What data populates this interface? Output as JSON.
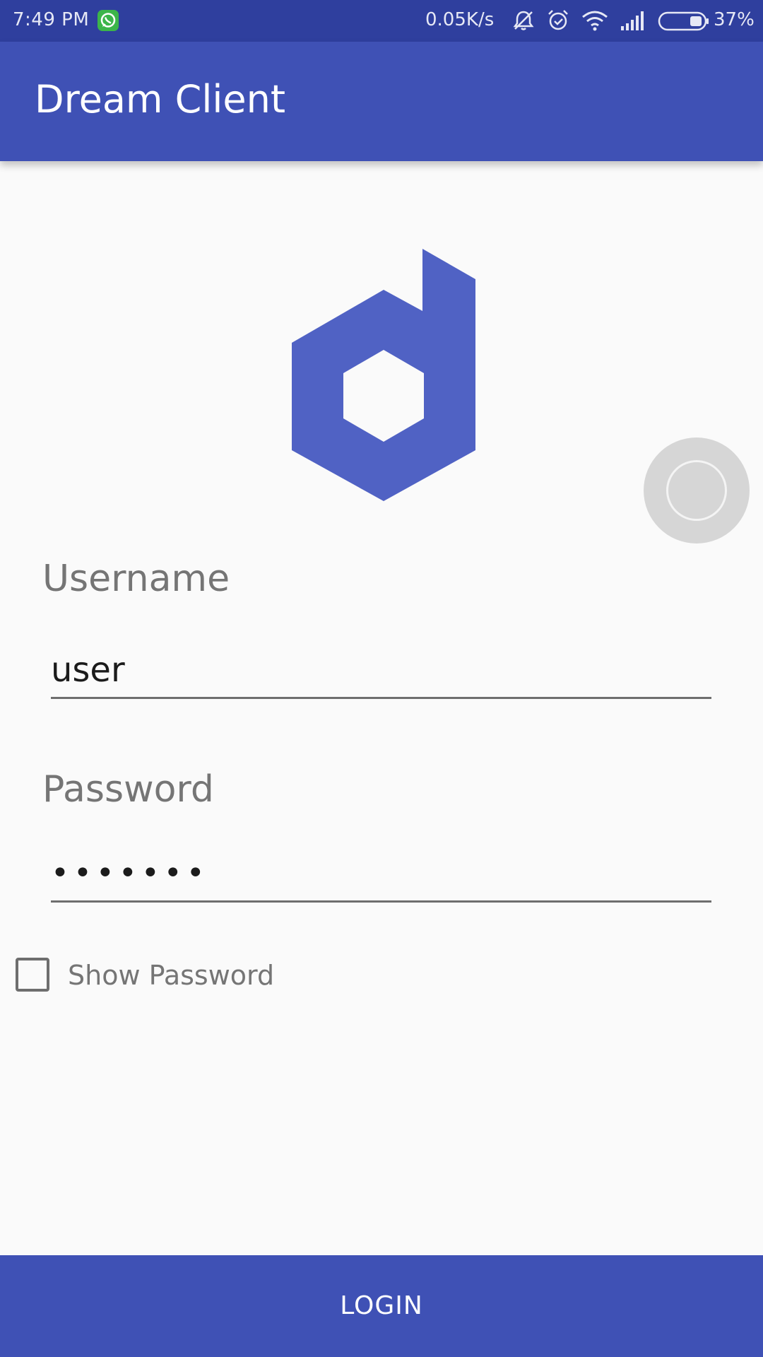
{
  "status_bar": {
    "time": "7:49 PM",
    "net_speed": "0.05K/s",
    "battery": "37%",
    "icons": [
      "whatsapp-icon",
      "bell-off-icon",
      "alarm-icon",
      "wifi-icon",
      "signal-icon",
      "battery-icon"
    ]
  },
  "app_bar": {
    "title": "Dream Client"
  },
  "logo": {
    "icon": "dream-logo-icon",
    "color": "#5062c4"
  },
  "login_form": {
    "username_label": "Username",
    "username_value": "user",
    "password_label": "Password",
    "password_value": "•••••••",
    "show_password_label": "Show Password",
    "show_password_checked": false
  },
  "login_button": {
    "label": "LOGIN"
  },
  "colors": {
    "primary": "#3f51b5",
    "primary_dark": "#2f3f9e",
    "background": "#fafafa"
  }
}
